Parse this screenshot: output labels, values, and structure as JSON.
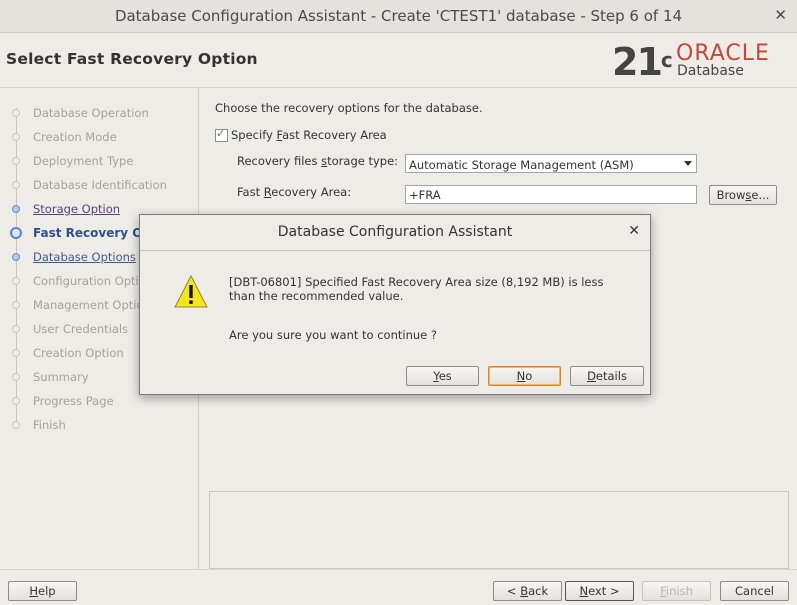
{
  "window": {
    "title": "Database Configuration Assistant - Create 'CTEST1' database - Step 6 of 14"
  },
  "header": {
    "page_title": "Select Fast Recovery Option",
    "logo_version": "21",
    "logo_version_sup": "c",
    "logo_brand": "ORACLE",
    "logo_product": "Database"
  },
  "nav": {
    "items": [
      {
        "label": "Database Operation",
        "state": "disabled"
      },
      {
        "label": "Creation Mode",
        "state": "disabled"
      },
      {
        "label": "Deployment Type",
        "state": "disabled"
      },
      {
        "label": "Database Identification",
        "state": "disabled"
      },
      {
        "label": "Storage Option",
        "state": "visited"
      },
      {
        "label": "Fast Recovery Op",
        "state": "current"
      },
      {
        "label": "Database Options",
        "state": "link"
      },
      {
        "label": "Configuration Optio",
        "state": "disabled"
      },
      {
        "label": "Management Optio",
        "state": "disabled"
      },
      {
        "label": "User Credentials",
        "state": "disabled"
      },
      {
        "label": "Creation Option",
        "state": "disabled"
      },
      {
        "label": "Summary",
        "state": "disabled"
      },
      {
        "label": "Progress Page",
        "state": "disabled"
      },
      {
        "label": "Finish",
        "state": "disabled"
      }
    ]
  },
  "content": {
    "intro": "Choose the recovery options for the database.",
    "specify_fra": {
      "label_pre": "Specify ",
      "label_ul": "F",
      "label_post": "ast Recovery Area",
      "checked": true
    },
    "storage_type": {
      "label_pre": "Recovery files ",
      "label_ul": "s",
      "label_post": "torage type:",
      "value": "Automatic Storage Management (ASM)"
    },
    "fra": {
      "label_pre": "Fast ",
      "label_ul": "R",
      "label_post": "ecovery Area:",
      "value": "+FRA"
    },
    "browse": {
      "pre": "Brow",
      "ul": "s",
      "post": "e..."
    }
  },
  "footer": {
    "help": {
      "ul": "H",
      "post": "elp"
    },
    "back": {
      "pre": "< ",
      "ul": "B",
      "post": "ack"
    },
    "next": {
      "ul": "N",
      "post": "ext >"
    },
    "finish": {
      "ul": "F",
      "post": "inish"
    },
    "cancel": "Cancel"
  },
  "dialog": {
    "title": "Database Configuration Assistant",
    "message": "[DBT-06801] Specified Fast Recovery Area size (8,192 MB) is less than the recommended value.",
    "question": "Are you sure you want to continue ?",
    "yes": {
      "ul": "Y",
      "post": "es"
    },
    "no": {
      "ul": "N",
      "post": "o"
    },
    "details": {
      "ul": "D",
      "post": "etails"
    }
  },
  "colors": {
    "accent": "#2f4f8e",
    "oracle_red": "#c74634",
    "warning": "#f5e61a"
  }
}
